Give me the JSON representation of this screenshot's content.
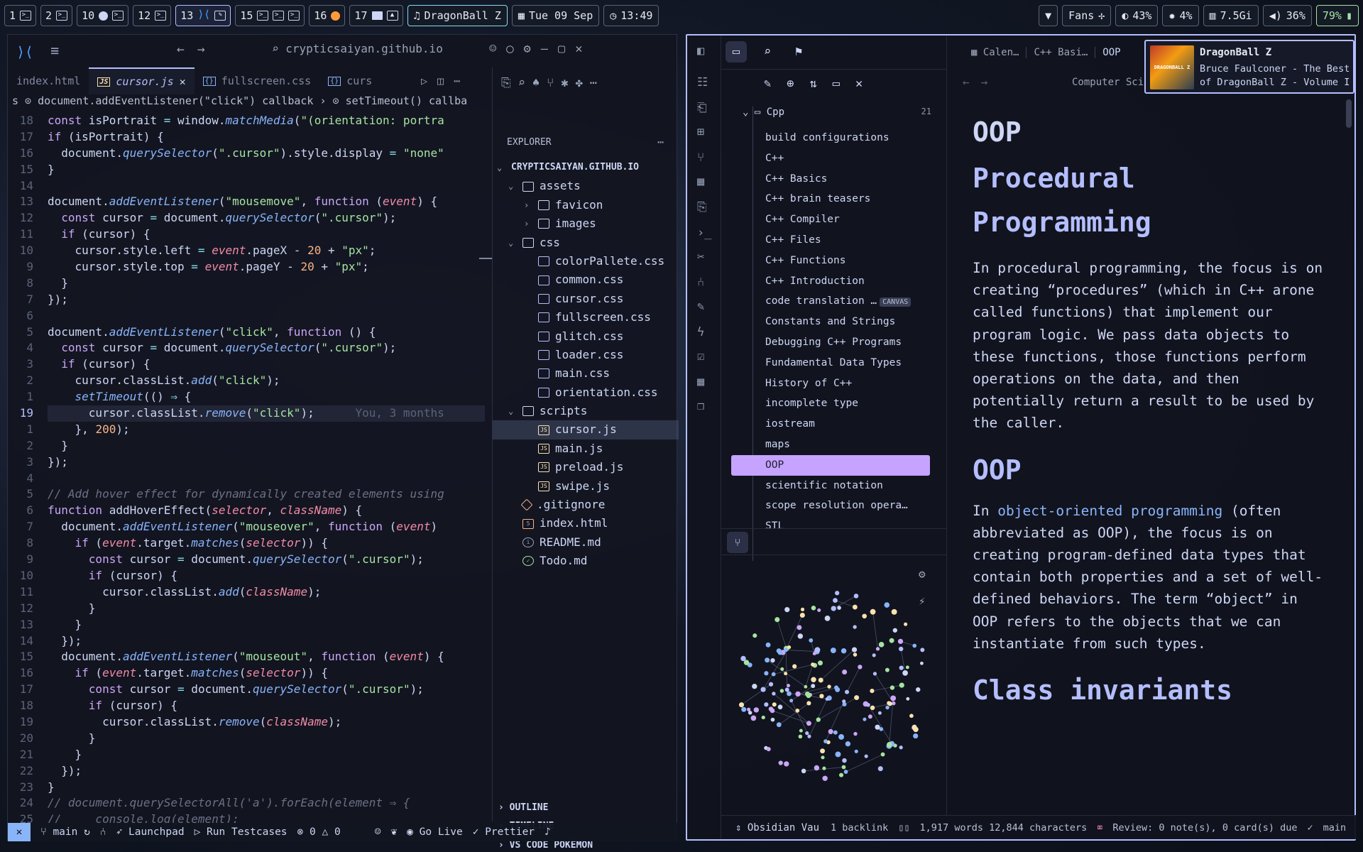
{
  "topbar": {
    "workspaces": [
      {
        "num": "1",
        "icons": [
          "terminal-icon"
        ]
      },
      {
        "num": "2",
        "icons": [
          "terminal-icon"
        ]
      },
      {
        "num": "10",
        "icons": [
          "spotify-icon",
          "terminal-icon"
        ]
      },
      {
        "num": "12",
        "icons": [
          "terminal-icon"
        ]
      },
      {
        "num": "13",
        "icons": [
          "vscode-icon",
          "edit-icon"
        ],
        "active": true
      },
      {
        "num": "15",
        "icons": [
          "terminal-icon",
          "terminal-icon",
          "terminal-icon"
        ]
      },
      {
        "num": "16",
        "icons": [
          "firefox-icon"
        ]
      },
      {
        "num": "17",
        "icons": [
          "folder-icon",
          "image-icon"
        ]
      }
    ],
    "music": "DragonBall Z",
    "date": "Tue 09 Sep",
    "time": "13:49",
    "fans": "Fans",
    "brightness": "43%",
    "cpu": "4%",
    "memory": "7.5Gi",
    "volume": "36%",
    "battery": "79%"
  },
  "vscode": {
    "search": "crypticsaiyan.github.io",
    "tabs": [
      {
        "label": "index.html",
        "type": "html"
      },
      {
        "label": "cursor.js",
        "type": "js",
        "active": true
      },
      {
        "label": "fullscreen.css",
        "type": "css"
      },
      {
        "label": "curs",
        "type": "css"
      }
    ],
    "breadcrumb": "s  ⊙ document.addEventListener(\"click\") callback  ›  ⊙ setTimeout() callba",
    "code_lines": [
      {
        "n": "18",
        "t": "const isPortrait = window.matchMedia(\"(orientation: portra"
      },
      {
        "n": "17",
        "t": "if (isPortrait) {"
      },
      {
        "n": "16",
        "t": "  document.querySelector(\".cursor\").style.display = \"none\""
      },
      {
        "n": "15",
        "t": "}"
      },
      {
        "n": "14",
        "t": ""
      },
      {
        "n": "13",
        "t": "document.addEventListener(\"mousemove\", function (event) {"
      },
      {
        "n": "12",
        "t": "  const cursor = document.querySelector(\".cursor\");"
      },
      {
        "n": "11",
        "t": "  if (cursor) {"
      },
      {
        "n": "10",
        "t": "    cursor.style.left = event.pageX - 20 + \"px\";"
      },
      {
        "n": "9",
        "t": "    cursor.style.top = event.pageY - 20 + \"px\";"
      },
      {
        "n": "8",
        "t": "  }"
      },
      {
        "n": "7",
        "t": "});"
      },
      {
        "n": "6",
        "t": ""
      },
      {
        "n": "5",
        "t": "document.addEventListener(\"click\", function () {"
      },
      {
        "n": "4",
        "t": "  const cursor = document.querySelector(\".cursor\");"
      },
      {
        "n": "3",
        "t": "  if (cursor) {"
      },
      {
        "n": "2",
        "t": "    cursor.classList.add(\"click\");"
      },
      {
        "n": "1",
        "t": "    setTimeout(() ⇒ {"
      },
      {
        "n": "19",
        "t": "      cursor.classList.remove(\"click\");      You, 3 months",
        "current": true
      },
      {
        "n": "1",
        "t": "    }, 200);"
      },
      {
        "n": "2",
        "t": "  }"
      },
      {
        "n": "3",
        "t": "});"
      },
      {
        "n": "4",
        "t": ""
      },
      {
        "n": "5",
        "t": "// Add hover effect for dynamically created elements using"
      },
      {
        "n": "6",
        "t": "function addHoverEffect(selector, className) {"
      },
      {
        "n": "7",
        "t": "  document.addEventListener(\"mouseover\", function (event)"
      },
      {
        "n": "8",
        "t": "    if (event.target.matches(selector)) {"
      },
      {
        "n": "9",
        "t": "      const cursor = document.querySelector(\".cursor\");"
      },
      {
        "n": "10",
        "t": "      if (cursor) {"
      },
      {
        "n": "11",
        "t": "        cursor.classList.add(className);"
      },
      {
        "n": "12",
        "t": "      }"
      },
      {
        "n": "13",
        "t": "    }"
      },
      {
        "n": "14",
        "t": "  });"
      },
      {
        "n": "15",
        "t": "  document.addEventListener(\"mouseout\", function (event) {"
      },
      {
        "n": "16",
        "t": "    if (event.target.matches(selector)) {"
      },
      {
        "n": "17",
        "t": "      const cursor = document.querySelector(\".cursor\");"
      },
      {
        "n": "18",
        "t": "      if (cursor) {"
      },
      {
        "n": "19",
        "t": "        cursor.classList.remove(className);"
      },
      {
        "n": "20",
        "t": "      }"
      },
      {
        "n": "21",
        "t": "    }"
      },
      {
        "n": "22",
        "t": "  });"
      },
      {
        "n": "23",
        "t": "}"
      },
      {
        "n": "24",
        "t": "// document.querySelectorAll('a').forEach(element ⇒ {"
      },
      {
        "n": "25",
        "t": "//     console.log(element);"
      }
    ],
    "explorer": {
      "header": "EXPLORER",
      "root": "CRYPTICSAIYAN.GITHUB.IO",
      "tree": [
        {
          "label": "assets",
          "depth": 1,
          "kind": "folder",
          "open": true
        },
        {
          "label": "favicon",
          "depth": 2,
          "kind": "folder"
        },
        {
          "label": "images",
          "depth": 2,
          "kind": "folder"
        },
        {
          "label": "css",
          "depth": 1,
          "kind": "folder",
          "open": true
        },
        {
          "label": "colorPallete.css",
          "depth": 2,
          "kind": "css"
        },
        {
          "label": "common.css",
          "depth": 2,
          "kind": "css"
        },
        {
          "label": "cursor.css",
          "depth": 2,
          "kind": "css"
        },
        {
          "label": "fullscreen.css",
          "depth": 2,
          "kind": "css"
        },
        {
          "label": "glitch.css",
          "depth": 2,
          "kind": "css"
        },
        {
          "label": "loader.css",
          "depth": 2,
          "kind": "css"
        },
        {
          "label": "main.css",
          "depth": 2,
          "kind": "css"
        },
        {
          "label": "orientation.css",
          "depth": 2,
          "kind": "css"
        },
        {
          "label": "scripts",
          "depth": 1,
          "kind": "folder",
          "open": true
        },
        {
          "label": "cursor.js",
          "depth": 2,
          "kind": "js",
          "selected": true
        },
        {
          "label": "main.js",
          "depth": 2,
          "kind": "js"
        },
        {
          "label": "preload.js",
          "depth": 2,
          "kind": "js"
        },
        {
          "label": "swipe.js",
          "depth": 2,
          "kind": "js"
        },
        {
          "label": ".gitignore",
          "depth": 1,
          "kind": "git"
        },
        {
          "label": "index.html",
          "depth": 1,
          "kind": "html"
        },
        {
          "label": "README.md",
          "depth": 1,
          "kind": "info"
        },
        {
          "label": "Todo.md",
          "depth": 1,
          "kind": "md"
        }
      ],
      "sections": [
        "OUTLINE",
        "TIMELINE",
        "VS CODE POKÉMON"
      ]
    },
    "status": {
      "branch": "main",
      "launchpad": "Launchpad",
      "run": "Run Testcases",
      "errors": "0",
      "warnings": "0",
      "golive": "Go Live",
      "prettier": "Prettier"
    }
  },
  "obsidian": {
    "tabs": [
      "Calen…",
      "C++ Basi…",
      "OOP"
    ],
    "breadcrumb": "Computer Sci",
    "folder": {
      "name": "Cpp",
      "count": "21"
    },
    "notes": [
      {
        "label": "build configurations"
      },
      {
        "label": "C++"
      },
      {
        "label": "C++ Basics"
      },
      {
        "label": "C++ brain teasers"
      },
      {
        "label": "C++ Compiler"
      },
      {
        "label": "C++ Files"
      },
      {
        "label": "C++ Functions"
      },
      {
        "label": "C++ Introduction"
      },
      {
        "label": "code translation …",
        "badge": "CANVAS"
      },
      {
        "label": "Constants and Strings"
      },
      {
        "label": "Debugging C++ Programs"
      },
      {
        "label": "Fundamental Data Types"
      },
      {
        "label": "History of C++"
      },
      {
        "label": "incomplete type"
      },
      {
        "label": "iostream"
      },
      {
        "label": "maps"
      },
      {
        "label": "OOP",
        "selected": true
      },
      {
        "label": "scientific notation"
      },
      {
        "label": "scope resolution opera…"
      },
      {
        "label": "STL"
      }
    ],
    "vault": "Obsidian Vau",
    "content": {
      "title": "OOP",
      "h_procedural": "Procedural Programming",
      "p_procedural": "In procedural programming, the focus is on creating “procedures” (which in C++ arone called functions) that implement our program logic. We pass data objects to these functions, those functions perform operations on the data, and then potentially return a result to be used by the caller.",
      "h_oop": "OOP",
      "p_oop_pre": "In ",
      "p_oop_link": "object-oriented programming",
      "p_oop_post": " (often abbreviated as OOP), the focus is on creating program-defined data types that contain both properties and a set of well-defined behaviors. The term “object” in OOP refers to the objects that we can instantiate from such types.",
      "h_class": "Class invariants"
    },
    "status": {
      "backlinks": "1 backlink",
      "words": "1,917 words 12,844 characters",
      "review": "Review: 0 note(s), 0 card(s) due",
      "branch": "main"
    }
  },
  "media": {
    "title": "DragonBall Z",
    "subtitle": "Bruce Faulconer - The Best of DragonBall Z - Volume I",
    "cover_text": "DRAGONBALL Z"
  },
  "colors": {
    "accent": "#b4befe",
    "selected_note": "#c5a3ff",
    "link": "#89b4fa",
    "heading": "#b4befe"
  }
}
